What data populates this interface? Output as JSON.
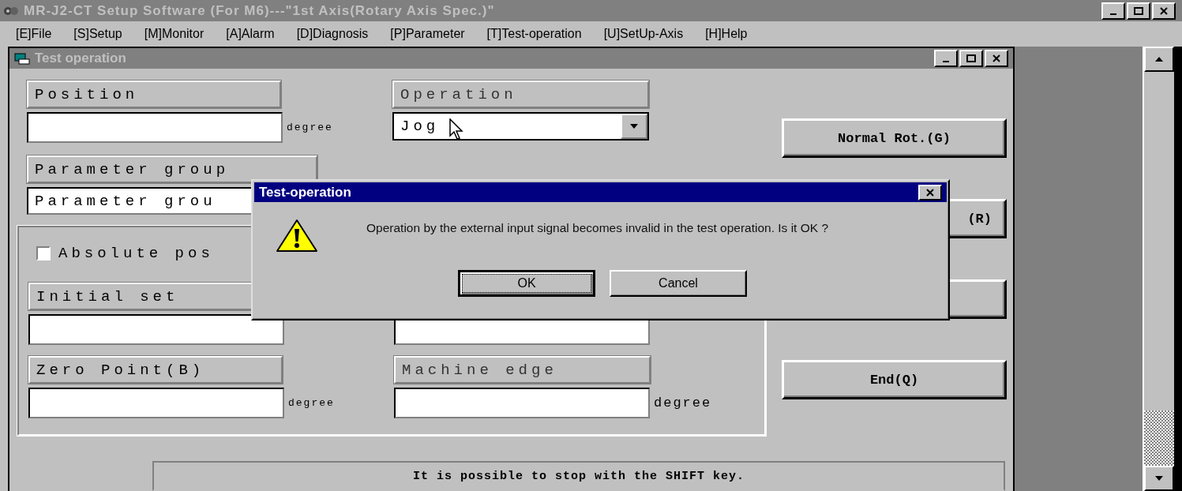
{
  "app": {
    "title": "MR-J2-CT Setup Software (For M6)---\"1st Axis(Rotary Axis Spec.)\"",
    "active": false
  },
  "menu": [
    {
      "label": "[E]File"
    },
    {
      "label": "[S]Setup"
    },
    {
      "label": "[M]Monitor"
    },
    {
      "label": "[A]Alarm"
    },
    {
      "label": "[D]Diagnosis"
    },
    {
      "label": "[P]Parameter"
    },
    {
      "label": "[T]Test-operation"
    },
    {
      "label": "[U]SetUp-Axis"
    },
    {
      "label": "[H]Help"
    }
  ],
  "child_window": {
    "title": "Test operation",
    "active": false
  },
  "position": {
    "label": "Position",
    "unit": "degree"
  },
  "operation": {
    "label": "Operation",
    "value": "Jog"
  },
  "parameter_group": {
    "label": "Parameter group",
    "value": "Parameter grou"
  },
  "absolute_position": {
    "label": "Absolute pos",
    "checked": false
  },
  "initial_set": {
    "label": "Initial set"
  },
  "zero_point": {
    "label": "Zero Point(B)",
    "unit": "degree"
  },
  "machine_edge": {
    "label": "Machine edge",
    "unit": "degree"
  },
  "buttons": [
    {
      "kind": "text",
      "label": "Normal Rot.(G)",
      "covered": false
    },
    {
      "kind": "text",
      "label": "(R)",
      "covered": true
    },
    {
      "kind": "blank"
    },
    {
      "kind": "text",
      "label": "End(Q)",
      "covered": false
    }
  ],
  "status": "It is possible to stop with the SHIFT key.",
  "dialog": {
    "title": "Test-operation",
    "message": "Operation by the external input signal becomes invalid in the test operation. Is it OK ?",
    "buttons": [
      {
        "label": "OK",
        "selected": true
      },
      {
        "label": "Cancel",
        "selected": false
      }
    ]
  }
}
